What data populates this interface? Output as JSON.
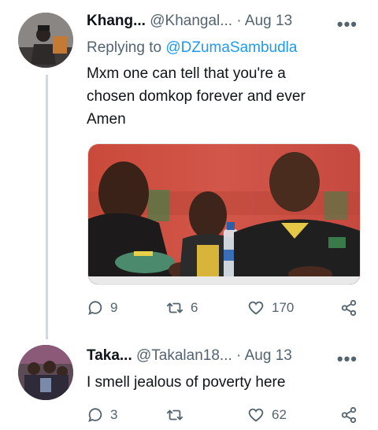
{
  "tweet1": {
    "name": "Khang...",
    "handle": "@Khangal...",
    "time": "· Aug 13",
    "more": "•••",
    "replying_prefix": "Replying to",
    "replying_handle": "@DZumaSambudla",
    "lines": [
      "Mxm one can tell that you're a",
      "chosen domkop forever and ever",
      "Amen"
    ],
    "stats": {
      "replies": "9",
      "retweets": "6",
      "likes": "170"
    }
  },
  "tweet2": {
    "name": "Taka...",
    "handle": "@Takalan18...",
    "time": "· Aug 13",
    "more": "•••",
    "text": "I smell jealous of poverty here",
    "stats": {
      "replies": "3",
      "retweets": "",
      "likes": "62"
    }
  },
  "icons": [
    "reply-icon",
    "retweet-icon",
    "like-icon",
    "share-icon",
    "more-icon"
  ],
  "colors": {
    "link": "#1d9bf0",
    "muted": "#536471",
    "text": "#0f1419",
    "thread_line": "#cfd9de"
  }
}
